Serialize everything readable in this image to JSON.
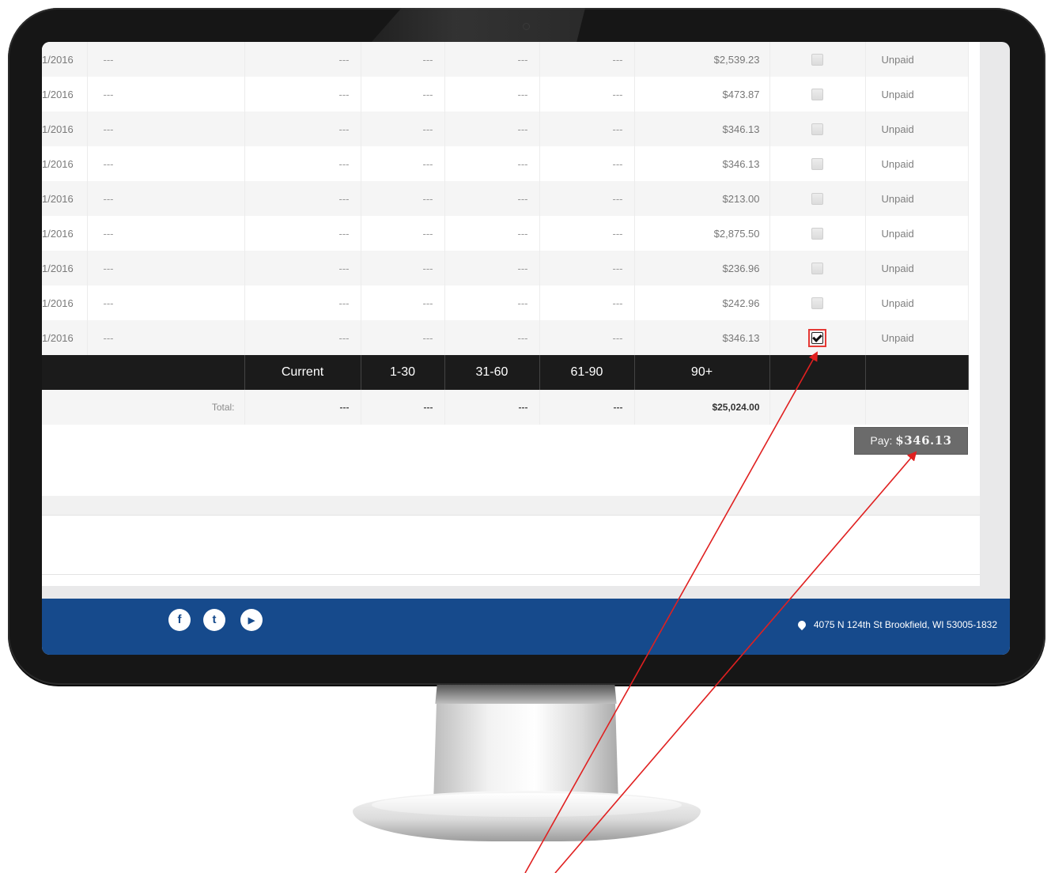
{
  "table": {
    "rows": [
      {
        "date": "1/2016",
        "desc": "---",
        "c1": "---",
        "c2": "---",
        "c3": "---",
        "c4": "---",
        "amount": "$2,539.23",
        "checked": false,
        "status": "Unpaid"
      },
      {
        "date": "1/2016",
        "desc": "---",
        "c1": "---",
        "c2": "---",
        "c3": "---",
        "c4": "---",
        "amount": "$473.87",
        "checked": false,
        "status": "Unpaid"
      },
      {
        "date": "1/2016",
        "desc": "---",
        "c1": "---",
        "c2": "---",
        "c3": "---",
        "c4": "---",
        "amount": "$346.13",
        "checked": false,
        "status": "Unpaid"
      },
      {
        "date": "1/2016",
        "desc": "---",
        "c1": "---",
        "c2": "---",
        "c3": "---",
        "c4": "---",
        "amount": "$346.13",
        "checked": false,
        "status": "Unpaid"
      },
      {
        "date": "1/2016",
        "desc": "---",
        "c1": "---",
        "c2": "---",
        "c3": "---",
        "c4": "---",
        "amount": "$213.00",
        "checked": false,
        "status": "Unpaid"
      },
      {
        "date": "1/2016",
        "desc": "---",
        "c1": "---",
        "c2": "---",
        "c3": "---",
        "c4": "---",
        "amount": "$2,875.50",
        "checked": false,
        "status": "Unpaid"
      },
      {
        "date": "1/2016",
        "desc": "---",
        "c1": "---",
        "c2": "---",
        "c3": "---",
        "c4": "---",
        "amount": "$236.96",
        "checked": false,
        "status": "Unpaid"
      },
      {
        "date": "1/2016",
        "desc": "---",
        "c1": "---",
        "c2": "---",
        "c3": "---",
        "c4": "---",
        "amount": "$242.96",
        "checked": false,
        "status": "Unpaid"
      },
      {
        "date": "1/2016",
        "desc": "---",
        "c1": "---",
        "c2": "---",
        "c3": "---",
        "c4": "---",
        "amount": "$346.13",
        "checked": true,
        "status": "Unpaid"
      }
    ],
    "aging_headers": [
      "Current",
      "1-30",
      "31-60",
      "61-90",
      "90+"
    ],
    "total": {
      "label": "Total:",
      "values": [
        "---",
        "---",
        "---",
        "---"
      ],
      "sum": "$25,024.00"
    }
  },
  "pay_button": {
    "prefix": "Pay:",
    "amount": "$346.13"
  },
  "footer": {
    "social": [
      {
        "icon": "facebook-icon",
        "glyph": "f"
      },
      {
        "icon": "twitter-icon",
        "glyph": "t"
      },
      {
        "icon": "youtube-icon",
        "glyph": "▶"
      }
    ],
    "address": "4075 N 124th St Brookfield, WI 53005-1832",
    "color": "#164a8c"
  },
  "annotation_color": "#e02020"
}
